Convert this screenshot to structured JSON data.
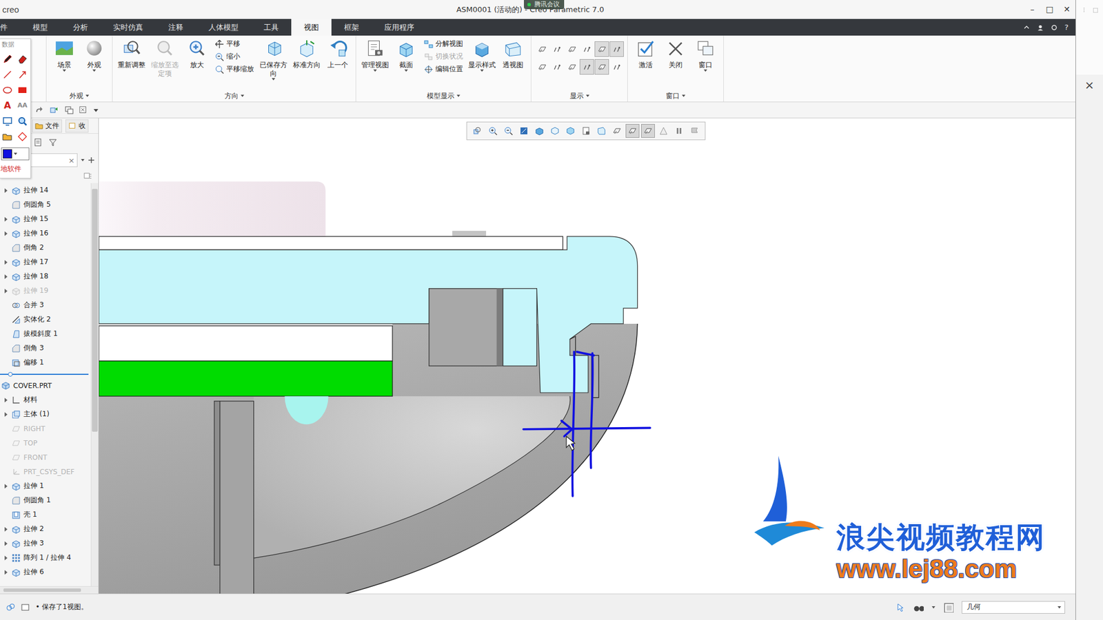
{
  "window": {
    "logo": "creo",
    "title": "ASM0001 (活动的) - Creo Parametric 7.0",
    "badge": "腾讯会议",
    "controls": [
      "–",
      "□",
      "✕"
    ]
  },
  "ribbon_tabs": [
    {
      "label": "件",
      "selected": false
    },
    {
      "label": "模型",
      "selected": false
    },
    {
      "label": "分析",
      "selected": false
    },
    {
      "label": "实时仿真",
      "selected": false
    },
    {
      "label": "注释",
      "selected": false
    },
    {
      "label": "人体模型",
      "selected": false
    },
    {
      "label": "工具",
      "selected": false
    },
    {
      "label": "视图",
      "selected": true
    },
    {
      "label": "框架",
      "selected": false
    },
    {
      "label": "应用程序",
      "selected": false
    }
  ],
  "help": "?",
  "ribbon_groups": [
    {
      "label": "外观",
      "dropdown": true,
      "items": [
        {
          "kind": "large",
          "icon": "scene",
          "label": "场景",
          "dropdown": true,
          "disabled": false
        },
        {
          "kind": "large",
          "icon": "appearance",
          "label": "外观",
          "dropdown": true,
          "disabled": false
        }
      ]
    },
    {
      "label": "方向",
      "dropdown": true,
      "items": [
        {
          "kind": "large",
          "icon": "refit",
          "label": "重新调整",
          "dropdown": false,
          "disabled": false
        },
        {
          "kind": "large",
          "icon": "zoom-selected",
          "label": "缩放至选定项",
          "dropdown": false,
          "disabled": true
        },
        {
          "kind": "large",
          "icon": "zoom-in",
          "label": "放大",
          "dropdown": false,
          "disabled": false
        },
        {
          "kind": "column",
          "items": [
            {
              "icon": "pan",
              "label": "平移",
              "disabled": false
            },
            {
              "icon": "zoom-out",
              "label": "缩小",
              "disabled": false
            },
            {
              "icon": "pan-zoom",
              "label": "平移缩放",
              "disabled": false
            }
          ]
        },
        {
          "kind": "large",
          "icon": "saved",
          "label": "已保存方向",
          "dropdown": true,
          "disabled": false
        },
        {
          "kind": "large",
          "icon": "std",
          "label": "标准方向",
          "dropdown": false,
          "disabled": false
        },
        {
          "kind": "large",
          "icon": "previous",
          "label": "上一个",
          "dropdown": false,
          "disabled": false
        }
      ]
    },
    {
      "label": "模型显示",
      "dropdown": true,
      "items": [
        {
          "kind": "large",
          "icon": "manage",
          "label": "管理视图",
          "dropdown": true,
          "disabled": false
        },
        {
          "kind": "large",
          "icon": "section",
          "label": "截面",
          "dropdown": true,
          "disabled": false
        },
        {
          "kind": "column",
          "items": [
            {
              "icon": "explode",
              "label": "分解视图",
              "disabled": false
            },
            {
              "icon": "toggle",
              "label": "切换状况",
              "disabled": true
            },
            {
              "icon": "edit",
              "label": "编辑位置",
              "disabled": false
            }
          ]
        },
        {
          "kind": "large",
          "icon": "style",
          "label": "显示样式",
          "dropdown": true,
          "disabled": false
        },
        {
          "kind": "large",
          "icon": "persp",
          "label": "透视图",
          "dropdown": false,
          "disabled": false
        }
      ]
    },
    {
      "label": "显示",
      "dropdown": true,
      "items": [
        {
          "kind": "toggles",
          "rows": [
            [
              {
                "on": false
              },
              {
                "on": false
              },
              {
                "on": false
              },
              {
                "on": false
              },
              {
                "on": true
              },
              {
                "on": true
              }
            ],
            [
              {
                "on": false
              },
              {
                "on": false
              },
              {
                "on": false
              },
              {
                "on": true
              },
              {
                "on": true
              },
              {
                "on": false
              }
            ]
          ]
        }
      ]
    },
    {
      "label": "窗口",
      "dropdown": true,
      "items": [
        {
          "kind": "large",
          "icon": "activate",
          "label": "激活",
          "dropdown": false,
          "disabled": false
        },
        {
          "kind": "large",
          "icon": "close",
          "label": "关闭",
          "dropdown": false,
          "disabled": false
        },
        {
          "kind": "large",
          "icon": "window",
          "label": "窗口",
          "dropdown": true,
          "disabled": false
        }
      ]
    }
  ],
  "annotation_toolbar": {
    "title": "数据",
    "tools": [
      {
        "kind": "pen",
        "label": ""
      },
      {
        "kind": "eraser",
        "label": ""
      },
      {
        "kind": "line",
        "label": ""
      },
      {
        "kind": "arrow",
        "label": ""
      },
      {
        "kind": "ellipse",
        "label": ""
      },
      {
        "kind": "rect",
        "label": ""
      },
      {
        "kind": "text",
        "label": "A"
      },
      {
        "kind": "text-small",
        "label": "AA"
      },
      {
        "kind": "screen",
        "label": ""
      },
      {
        "kind": "zoom",
        "label": ""
      },
      {
        "kind": "folder",
        "label": ""
      },
      {
        "kind": "diamond",
        "label": ""
      }
    ],
    "pen_color": "#1010e0",
    "footer": "地软件"
  },
  "model_tree": {
    "tabs": [
      {
        "label": "文件",
        "selected": false
      },
      {
        "label": "收",
        "selected": false
      }
    ],
    "search": {
      "value": "",
      "clear": "×"
    },
    "rows": [
      {
        "label": "拉伸 14",
        "kind": "extrude",
        "depth": 1,
        "expandable": true,
        "expanded": false,
        "disabled": false
      },
      {
        "label": "倒圆角 5",
        "kind": "round",
        "depth": 1,
        "expandable": false,
        "expanded": false,
        "disabled": false
      },
      {
        "label": "拉伸 15",
        "kind": "extrude",
        "depth": 1,
        "expandable": true,
        "expanded": false,
        "disabled": false
      },
      {
        "label": "拉伸 16",
        "kind": "extrude",
        "depth": 1,
        "expandable": true,
        "expanded": false,
        "disabled": false
      },
      {
        "label": "倒角 2",
        "kind": "chamfer",
        "depth": 1,
        "expandable": false,
        "expanded": false,
        "disabled": false
      },
      {
        "label": "拉伸 17",
        "kind": "extrude",
        "depth": 1,
        "expandable": true,
        "expanded": false,
        "disabled": false
      },
      {
        "label": "拉伸 18",
        "kind": "extrude",
        "depth": 1,
        "expandable": true,
        "expanded": false,
        "disabled": false
      },
      {
        "label": "拉伸 19",
        "kind": "extrude",
        "depth": 1,
        "expandable": true,
        "expanded": false,
        "disabled": true
      },
      {
        "label": "合并 3",
        "kind": "merge",
        "depth": 1,
        "expandable": false,
        "expanded": false,
        "disabled": false
      },
      {
        "label": "实体化 2",
        "kind": "solidify",
        "depth": 1,
        "expandable": false,
        "expanded": false,
        "disabled": false
      },
      {
        "label": "拔模斜度 1",
        "kind": "draft",
        "depth": 1,
        "expandable": false,
        "expanded": false,
        "disabled": false
      },
      {
        "label": "倒角 3",
        "kind": "chamfer",
        "depth": 1,
        "expandable": false,
        "expanded": false,
        "disabled": false
      },
      {
        "label": "偏移 1",
        "kind": "offset",
        "depth": 1,
        "expandable": false,
        "expanded": false,
        "disabled": false
      },
      {
        "label": "COVER.PRT",
        "kind": "part",
        "depth": 0,
        "expandable": true,
        "expanded": true,
        "disabled": false
      },
      {
        "label": "材料",
        "kind": "material",
        "depth": 1,
        "expandable": true,
        "expanded": false,
        "disabled": false
      },
      {
        "label": "主体 (1)",
        "kind": "body",
        "depth": 1,
        "expandable": true,
        "expanded": false,
        "disabled": false
      },
      {
        "label": "RIGHT",
        "kind": "plane",
        "depth": 1,
        "expandable": false,
        "expanded": false,
        "disabled": true
      },
      {
        "label": "TOP",
        "kind": "plane",
        "depth": 1,
        "expandable": false,
        "expanded": false,
        "disabled": true
      },
      {
        "label": "FRONT",
        "kind": "plane",
        "depth": 1,
        "expandable": false,
        "expanded": false,
        "disabled": true
      },
      {
        "label": "PRT_CSYS_DEF",
        "kind": "csys",
        "depth": 1,
        "expandable": false,
        "expanded": false,
        "disabled": true
      },
      {
        "label": "拉伸 1",
        "kind": "extrude",
        "depth": 1,
        "expandable": true,
        "expanded": false,
        "disabled": false
      },
      {
        "label": "倒圆角 1",
        "kind": "round",
        "depth": 1,
        "expandable": false,
        "expanded": false,
        "disabled": false
      },
      {
        "label": "壳 1",
        "kind": "shell",
        "depth": 1,
        "expandable": false,
        "expanded": false,
        "disabled": false
      },
      {
        "label": "拉伸 2",
        "kind": "extrude",
        "depth": 1,
        "expandable": true,
        "expanded": false,
        "disabled": false
      },
      {
        "label": "拉伸 3",
        "kind": "extrude",
        "depth": 1,
        "expandable": true,
        "expanded": false,
        "disabled": false
      },
      {
        "label": "阵列 1 / 拉伸 4",
        "kind": "pattern",
        "depth": 1,
        "expandable": true,
        "expanded": false,
        "disabled": false
      },
      {
        "label": "拉伸 6",
        "kind": "extrude",
        "depth": 1,
        "expandable": true,
        "expanded": false,
        "disabled": false
      }
    ],
    "insert_after": 12,
    "scroll": {
      "level": 0.62
    }
  },
  "view_toolbar": [
    {
      "kind": "refit",
      "on": false
    },
    {
      "kind": "zoom-in",
      "on": false
    },
    {
      "kind": "zoom-out",
      "on": false
    },
    {
      "kind": "repaint",
      "on": false
    },
    {
      "kind": "style",
      "on": false
    },
    {
      "kind": "saved",
      "on": false
    },
    {
      "kind": "section",
      "on": false
    },
    {
      "kind": "manage",
      "on": false
    },
    {
      "kind": "persp",
      "on": false
    },
    {
      "kind": "datum",
      "on": false
    },
    {
      "kind": "datum",
      "on": true
    },
    {
      "kind": "datum",
      "on": true
    },
    {
      "kind": "triangle",
      "on": false
    },
    {
      "kind": "pause",
      "on": false
    },
    {
      "kind": "flag",
      "on": false
    }
  ],
  "watermark": {
    "title": "浪尖视频教程网",
    "url": "www.lej88.com"
  },
  "status_bar": {
    "bullet": "•",
    "message": "保存了1视图。",
    "filter": "几何"
  },
  "side_panel": {
    "close": "×"
  }
}
